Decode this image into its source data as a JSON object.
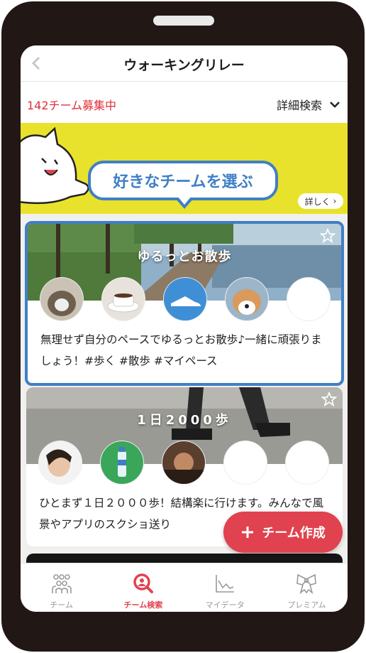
{
  "nav": {
    "title": "ウォーキングリレー"
  },
  "filter": {
    "team_count": "142チーム募集中",
    "detail_search": "詳細検索"
  },
  "banner": {
    "bubble_text": "好きなチームを選ぶ",
    "more_label": "詳しく"
  },
  "cards": [
    {
      "title": "ゆるっとお散歩",
      "description": "無理せず自分のペースでゆるっとお散歩♪一緒に頑張りましょう！#歩く #散歩 #マイペース"
    },
    {
      "title": "1日2000歩",
      "description": "ひとまず１日２０００歩！結構楽に行けます。みんなで風景やアプリのスクショ送り"
    }
  ],
  "fab": {
    "label": "チーム作成"
  },
  "tabs": [
    {
      "label": "チーム",
      "icon": "team-icon"
    },
    {
      "label": "チーム検索",
      "icon": "team-search-icon"
    },
    {
      "label": "マイデータ",
      "icon": "my-data-icon"
    },
    {
      "label": "プレミアム",
      "icon": "premium-icon"
    }
  ],
  "colors": {
    "accent_red": "#e0424f",
    "accent_blue": "#3f7fc6",
    "banner_yellow": "#e9e22c",
    "frame": "#211714"
  }
}
